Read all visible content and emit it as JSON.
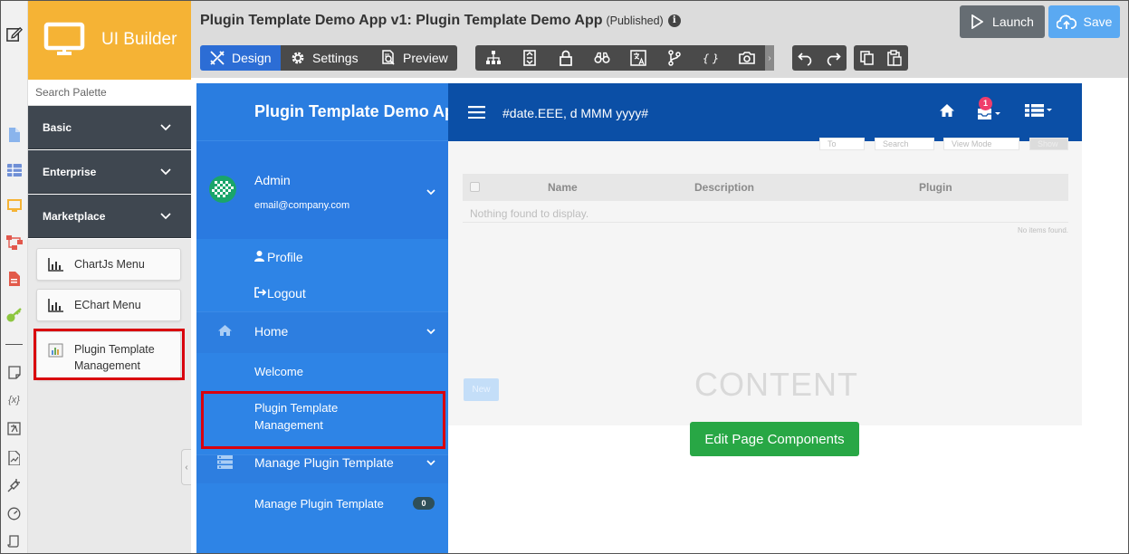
{
  "palette": {
    "brand": "UI Builder",
    "search_placeholder": "Search Palette",
    "categories": [
      {
        "label": "Basic"
      },
      {
        "label": "Enterprise"
      },
      {
        "label": "Marketplace"
      }
    ],
    "items": [
      {
        "label": "ChartJs Menu"
      },
      {
        "label": "EChart Menu"
      },
      {
        "label": "Plugin Template Management"
      }
    ]
  },
  "header": {
    "title": "Plugin Template Demo App v1: Plugin Template Demo App",
    "status": "(Published)",
    "modes": [
      {
        "label": "Design"
      },
      {
        "label": "Settings"
      },
      {
        "label": "Preview"
      }
    ],
    "launch_label": "Launch",
    "save_label": "Save"
  },
  "app": {
    "sidebar_title": "Plugin Template Demo App",
    "user_name": "Admin",
    "user_email": "email@company.com",
    "menu": [
      {
        "label": "Profile"
      },
      {
        "label": "Logout"
      },
      {
        "label": "Home"
      },
      {
        "label": "Welcome"
      },
      {
        "label": "Plugin Template Management"
      },
      {
        "label": "Manage Plugin Template"
      },
      {
        "label": "Manage Plugin Template"
      }
    ],
    "badge_count": "0",
    "nav_date": "#date.EEE, d MMM yyyy#",
    "notification_count": "1",
    "table": {
      "filters": [
        "To",
        "Search",
        "View Mode",
        "Show"
      ],
      "columns": [
        "Name",
        "Description",
        "Plugin"
      ],
      "empty_text": "Nothing found to display.",
      "no_items": "No items found."
    },
    "new_label": "New",
    "content_title": "CONTENT",
    "edit_label": "Edit Page Components"
  },
  "colors": {
    "brand": "#f5b335",
    "primary": "#2c6dd5",
    "sidebar": "#2d7ee0",
    "navbar": "#0b4fa6",
    "edit_button": "#28a745",
    "highlight": "#d9000d"
  }
}
